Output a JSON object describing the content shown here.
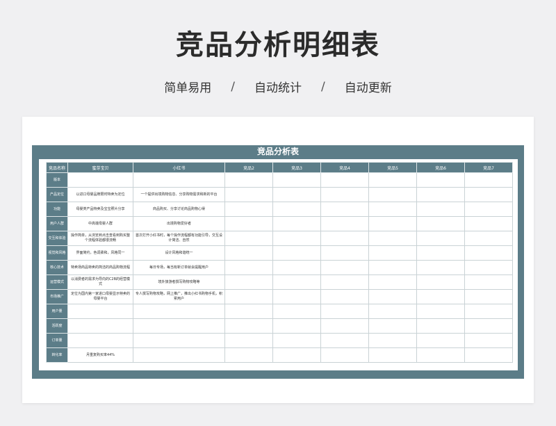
{
  "header": {
    "title": "竞品分析明细表",
    "tags": [
      "简单易用",
      "自动统计",
      "自动更新"
    ],
    "separator": "/"
  },
  "sheet": {
    "title": "竞品分析表",
    "columns": [
      "竞品名称",
      "蜜芽宝贝",
      "小红书",
      "竞品2",
      "竞品3",
      "竞品4",
      "竞品5",
      "竞品6",
      "竞品7"
    ],
    "rows": [
      {
        "label": "版本",
        "cells": [
          "",
          "",
          "",
          "",
          "",
          "",
          "",
          ""
        ]
      },
      {
        "label": "产品定位",
        "cells": [
          "以进口母婴品牌限时特卖为定位",
          "一个提供出境购物信息、分享购物需求和新的平台",
          "",
          "",
          "",
          "",
          "",
          ""
        ]
      },
      {
        "label": "功能",
        "cells": [
          "母婴类产品特卖及宝宝照片分享",
          "商品购买、分享讨论商品购物心得",
          "",
          "",
          "",
          "",
          "",
          ""
        ]
      },
      {
        "label": "用户人群",
        "cells": [
          "中高端母婴人群",
          "出境购物爱好者",
          "",
          "",
          "",
          "",
          "",
          ""
        ]
      },
      {
        "label": "交互和体验",
        "cells": [
          "操作简单，从浏览到点击查看到购买整个流程体验都很流畅",
          "首次打开小红书时，每个操作流程都有功能引导，交互设计简洁、自然",
          "",
          "",
          "",
          "",
          "",
          ""
        ]
      },
      {
        "label": "视觉和风格",
        "cells": [
          "界面简约，色调柔和，风格同一",
          "设计风格和谐统一",
          "",
          "",
          "",
          "",
          "",
          ""
        ]
      },
      {
        "label": "核心技术",
        "cells": [
          "特卖场商品特卖的简洁的商品购物流程",
          "每日专场，每当有新订单就会提醒用户",
          "",
          "",
          "",
          "",
          "",
          ""
        ]
      },
      {
        "label": "运营模式",
        "cells": [
          "以消费者的需求为导向的C2B的经营模式",
          "境外旅游者撰写购物攻略等",
          "",
          "",
          "",
          "",
          "",
          ""
        ]
      },
      {
        "label": "市场推广",
        "cells": [
          "定位为国内第一家进口母婴显示特卖的母婴平台",
          "专人撰写购物攻略，网上推广，推出小红书购物手机，积累用户",
          "",
          "",
          "",
          "",
          "",
          ""
        ]
      },
      {
        "label": "用户量",
        "cells": [
          "",
          "",
          "",
          "",
          "",
          "",
          "",
          ""
        ]
      },
      {
        "label": "活跃度",
        "cells": [
          "",
          "",
          "",
          "",
          "",
          "",
          "",
          ""
        ]
      },
      {
        "label": "订单量",
        "cells": [
          "",
          "",
          "",
          "",
          "",
          "",
          "",
          ""
        ]
      },
      {
        "label": "转化率",
        "cells": [
          "月重复购买率44%",
          "",
          "",
          "",
          "",
          "",
          "",
          ""
        ]
      }
    ]
  }
}
